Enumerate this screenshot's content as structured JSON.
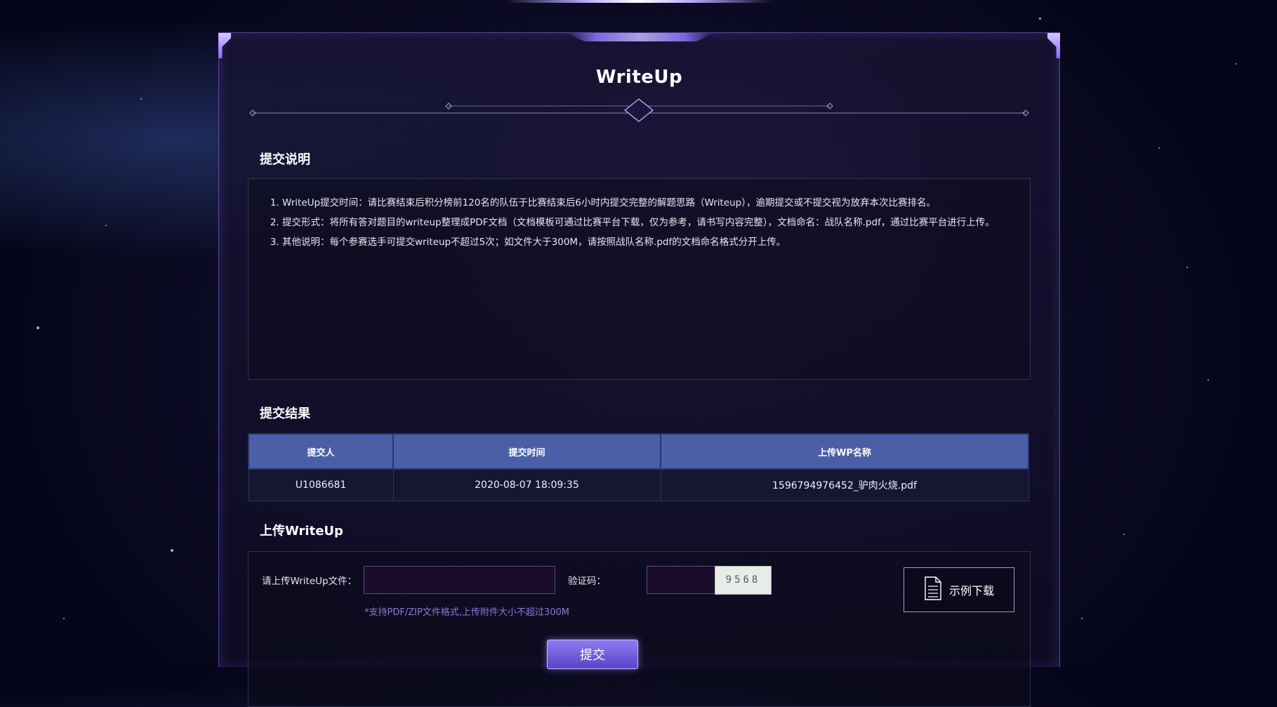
{
  "page": {
    "title": "WriteUp"
  },
  "instructions": {
    "heading": "提交说明",
    "items": [
      "WriteUp提交时间：请比赛结束后积分榜前120名的队伍于比赛结束后6小时内提交完整的解题思路（Writeup），逾期提交或不提交视为放弃本次比赛排名。",
      "提交形式：将所有答对题目的writeup整理成PDF文档（文档模板可通过比赛平台下载，仅为参考，请书写内容完整），文档命名：战队名称.pdf，通过比赛平台进行上传。",
      "其他说明：每个参赛选手可提交writeup不超过5次；如文件大于300M，请按照战队名称.pdf的文档命名格式分开上传。"
    ]
  },
  "results": {
    "heading": "提交结果",
    "columns": [
      "提交人",
      "提交时间",
      "上传WP名称"
    ],
    "rows": [
      [
        "U1086681",
        "2020-08-07 18:09:35",
        "1596794976452_驴肉火烧.pdf"
      ]
    ]
  },
  "upload": {
    "heading": "上传WriteUp",
    "file_label": "请上传WriteUp文件：",
    "captcha_label": "验证码：",
    "captcha_text": "9568",
    "hint": "*支持PDF/ZIP文件格式,上传附件大小不超过300M",
    "download_label": "示例下载",
    "submit_label": "提交"
  },
  "icons": {
    "download": "document-icon"
  },
  "colors": {
    "accent": "#8f7cf0",
    "table_header": "#4a5fa8",
    "hint": "#8a7bd8"
  }
}
